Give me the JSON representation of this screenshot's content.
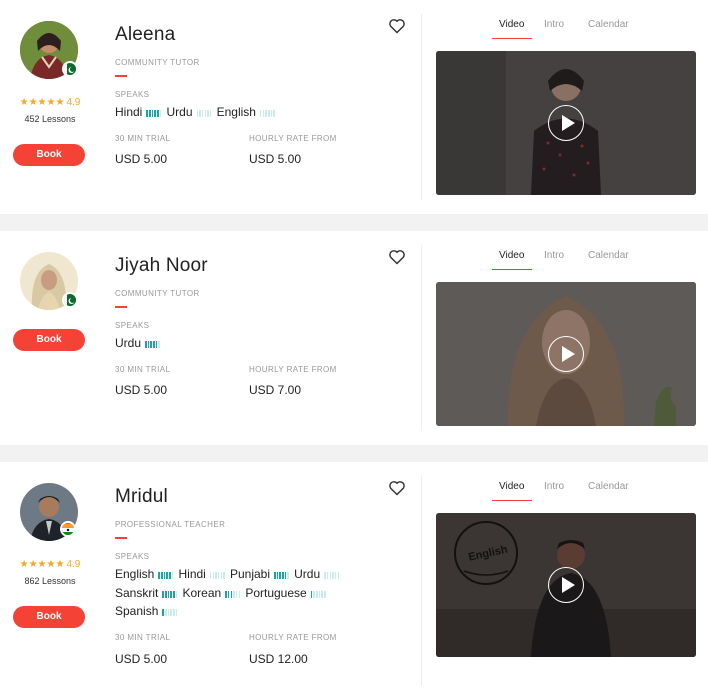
{
  "tutors": [
    {
      "name": "Aleena",
      "type": "COMMUNITY TUTOR",
      "flag": "pakistan-flag",
      "rating": "4.9",
      "lessons": "452 Lessons",
      "book_label": "Book",
      "speaks_label": "SPEAKS",
      "languages": [
        {
          "name": "Hindi",
          "level": 5
        },
        {
          "name": "Urdu",
          "level": 0
        },
        {
          "name": "English",
          "level": 0
        }
      ],
      "trial_label": "30 MIN TRIAL",
      "trial_value": "USD 5.00",
      "rate_label": "HOURLY RATE FROM",
      "rate_value": "USD 5.00",
      "tabs": [
        "Video",
        "Intro",
        "Calendar"
      ]
    },
    {
      "name": "Jiyah Noor",
      "type": "COMMUNITY TUTOR",
      "flag": "pakistan-flag",
      "book_label": "Book",
      "speaks_label": "SPEAKS",
      "languages": [
        {
          "name": "Urdu",
          "level": 5
        }
      ],
      "trial_label": "30 MIN TRIAL",
      "trial_value": "USD 5.00",
      "rate_label": "HOURLY RATE FROM",
      "rate_value": "USD 7.00",
      "tabs": [
        "Video",
        "Intro",
        "Calendar"
      ]
    },
    {
      "name": "Mridul",
      "type": "PROFESSIONAL TEACHER",
      "flag": "india-flag",
      "rating": "4.9",
      "lessons": "862 Lessons",
      "book_label": "Book",
      "speaks_label": "SPEAKS",
      "languages": [
        {
          "name": "English",
          "level": 5
        },
        {
          "name": "Hindi",
          "level": 0
        },
        {
          "name": "Punjabi",
          "level": 5
        },
        {
          "name": "Urdu",
          "level": 0
        },
        {
          "name": "Sanskrit",
          "level": 5
        },
        {
          "name": "Korean",
          "level": 3
        },
        {
          "name": "Portuguese",
          "level": 1
        },
        {
          "name": "Spanish",
          "level": 1
        }
      ],
      "trial_label": "30 MIN TRIAL",
      "trial_value": "USD 5.00",
      "rate_label": "HOURLY RATE FROM",
      "rate_value": "USD 12.00",
      "tabs": [
        "Video",
        "Intro",
        "Calendar"
      ],
      "video_overlay_text": "English"
    }
  ],
  "colors": {
    "accent": "#f44336",
    "star": "#f5a623",
    "level_bar": "#19a5a8"
  },
  "icons": {
    "favorite": "heart-outline-icon",
    "play": "play-circle-icon",
    "star": "star-icon"
  }
}
